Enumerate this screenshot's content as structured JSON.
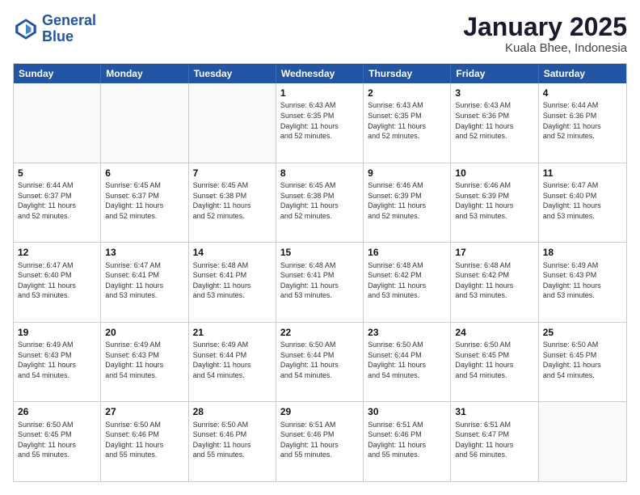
{
  "header": {
    "logo_line1": "General",
    "logo_line2": "Blue",
    "month": "January 2025",
    "location": "Kuala Bhee, Indonesia"
  },
  "weekdays": [
    "Sunday",
    "Monday",
    "Tuesday",
    "Wednesday",
    "Thursday",
    "Friday",
    "Saturday"
  ],
  "rows": [
    [
      {
        "day": "",
        "info": ""
      },
      {
        "day": "",
        "info": ""
      },
      {
        "day": "",
        "info": ""
      },
      {
        "day": "1",
        "info": "Sunrise: 6:43 AM\nSunset: 6:35 PM\nDaylight: 11 hours\nand 52 minutes."
      },
      {
        "day": "2",
        "info": "Sunrise: 6:43 AM\nSunset: 6:35 PM\nDaylight: 11 hours\nand 52 minutes."
      },
      {
        "day": "3",
        "info": "Sunrise: 6:43 AM\nSunset: 6:36 PM\nDaylight: 11 hours\nand 52 minutes."
      },
      {
        "day": "4",
        "info": "Sunrise: 6:44 AM\nSunset: 6:36 PM\nDaylight: 11 hours\nand 52 minutes."
      }
    ],
    [
      {
        "day": "5",
        "info": "Sunrise: 6:44 AM\nSunset: 6:37 PM\nDaylight: 11 hours\nand 52 minutes."
      },
      {
        "day": "6",
        "info": "Sunrise: 6:45 AM\nSunset: 6:37 PM\nDaylight: 11 hours\nand 52 minutes."
      },
      {
        "day": "7",
        "info": "Sunrise: 6:45 AM\nSunset: 6:38 PM\nDaylight: 11 hours\nand 52 minutes."
      },
      {
        "day": "8",
        "info": "Sunrise: 6:45 AM\nSunset: 6:38 PM\nDaylight: 11 hours\nand 52 minutes."
      },
      {
        "day": "9",
        "info": "Sunrise: 6:46 AM\nSunset: 6:39 PM\nDaylight: 11 hours\nand 52 minutes."
      },
      {
        "day": "10",
        "info": "Sunrise: 6:46 AM\nSunset: 6:39 PM\nDaylight: 11 hours\nand 53 minutes."
      },
      {
        "day": "11",
        "info": "Sunrise: 6:47 AM\nSunset: 6:40 PM\nDaylight: 11 hours\nand 53 minutes."
      }
    ],
    [
      {
        "day": "12",
        "info": "Sunrise: 6:47 AM\nSunset: 6:40 PM\nDaylight: 11 hours\nand 53 minutes."
      },
      {
        "day": "13",
        "info": "Sunrise: 6:47 AM\nSunset: 6:41 PM\nDaylight: 11 hours\nand 53 minutes."
      },
      {
        "day": "14",
        "info": "Sunrise: 6:48 AM\nSunset: 6:41 PM\nDaylight: 11 hours\nand 53 minutes."
      },
      {
        "day": "15",
        "info": "Sunrise: 6:48 AM\nSunset: 6:41 PM\nDaylight: 11 hours\nand 53 minutes."
      },
      {
        "day": "16",
        "info": "Sunrise: 6:48 AM\nSunset: 6:42 PM\nDaylight: 11 hours\nand 53 minutes."
      },
      {
        "day": "17",
        "info": "Sunrise: 6:48 AM\nSunset: 6:42 PM\nDaylight: 11 hours\nand 53 minutes."
      },
      {
        "day": "18",
        "info": "Sunrise: 6:49 AM\nSunset: 6:43 PM\nDaylight: 11 hours\nand 53 minutes."
      }
    ],
    [
      {
        "day": "19",
        "info": "Sunrise: 6:49 AM\nSunset: 6:43 PM\nDaylight: 11 hours\nand 54 minutes."
      },
      {
        "day": "20",
        "info": "Sunrise: 6:49 AM\nSunset: 6:43 PM\nDaylight: 11 hours\nand 54 minutes."
      },
      {
        "day": "21",
        "info": "Sunrise: 6:49 AM\nSunset: 6:44 PM\nDaylight: 11 hours\nand 54 minutes."
      },
      {
        "day": "22",
        "info": "Sunrise: 6:50 AM\nSunset: 6:44 PM\nDaylight: 11 hours\nand 54 minutes."
      },
      {
        "day": "23",
        "info": "Sunrise: 6:50 AM\nSunset: 6:44 PM\nDaylight: 11 hours\nand 54 minutes."
      },
      {
        "day": "24",
        "info": "Sunrise: 6:50 AM\nSunset: 6:45 PM\nDaylight: 11 hours\nand 54 minutes."
      },
      {
        "day": "25",
        "info": "Sunrise: 6:50 AM\nSunset: 6:45 PM\nDaylight: 11 hours\nand 54 minutes."
      }
    ],
    [
      {
        "day": "26",
        "info": "Sunrise: 6:50 AM\nSunset: 6:45 PM\nDaylight: 11 hours\nand 55 minutes."
      },
      {
        "day": "27",
        "info": "Sunrise: 6:50 AM\nSunset: 6:46 PM\nDaylight: 11 hours\nand 55 minutes."
      },
      {
        "day": "28",
        "info": "Sunrise: 6:50 AM\nSunset: 6:46 PM\nDaylight: 11 hours\nand 55 minutes."
      },
      {
        "day": "29",
        "info": "Sunrise: 6:51 AM\nSunset: 6:46 PM\nDaylight: 11 hours\nand 55 minutes."
      },
      {
        "day": "30",
        "info": "Sunrise: 6:51 AM\nSunset: 6:46 PM\nDaylight: 11 hours\nand 55 minutes."
      },
      {
        "day": "31",
        "info": "Sunrise: 6:51 AM\nSunset: 6:47 PM\nDaylight: 11 hours\nand 56 minutes."
      },
      {
        "day": "",
        "info": ""
      }
    ]
  ]
}
